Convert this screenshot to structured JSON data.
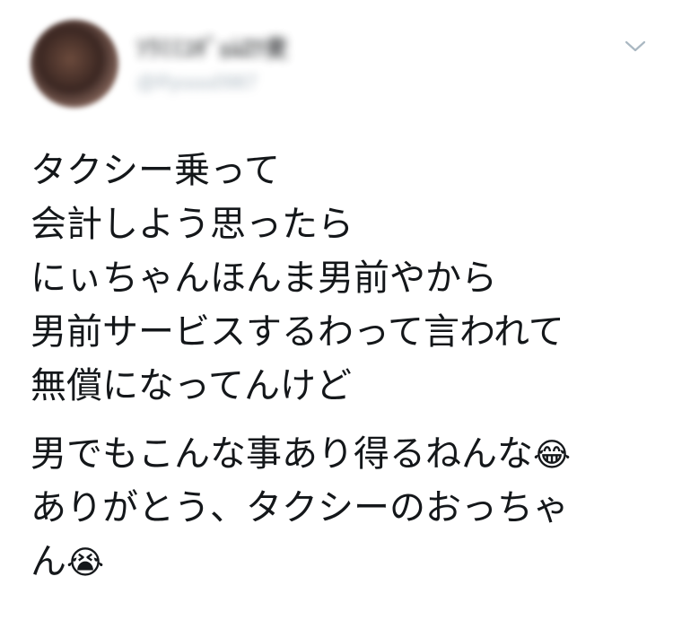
{
  "tweet": {
    "display_name": "ｿﾗﾐﾐﾕｷﾞｮﾑﾛﾂ麦",
    "handle": "@Ryuuu0987",
    "menu_icon": "chevron-down-icon",
    "paragraphs": [
      [
        {
          "text": "タクシー乗って"
        },
        {
          "text": "会計しよう思ったら"
        },
        {
          "text": "にぃちゃんほんま男前やから"
        },
        {
          "text": "男前サービスするわって言われて"
        },
        {
          "text": "無償になってんけど"
        }
      ],
      [
        {
          "text": "男でもこんな事あり得るねんな",
          "emoji": "😂",
          "emoji_name": "face-with-tears-of-joy-icon"
        },
        {
          "text": "ありがとう、タクシーのおっちゃ"
        },
        {
          "text": "ん",
          "emoji": "😭",
          "emoji_name": "loudly-crying-face-icon"
        }
      ]
    ]
  }
}
